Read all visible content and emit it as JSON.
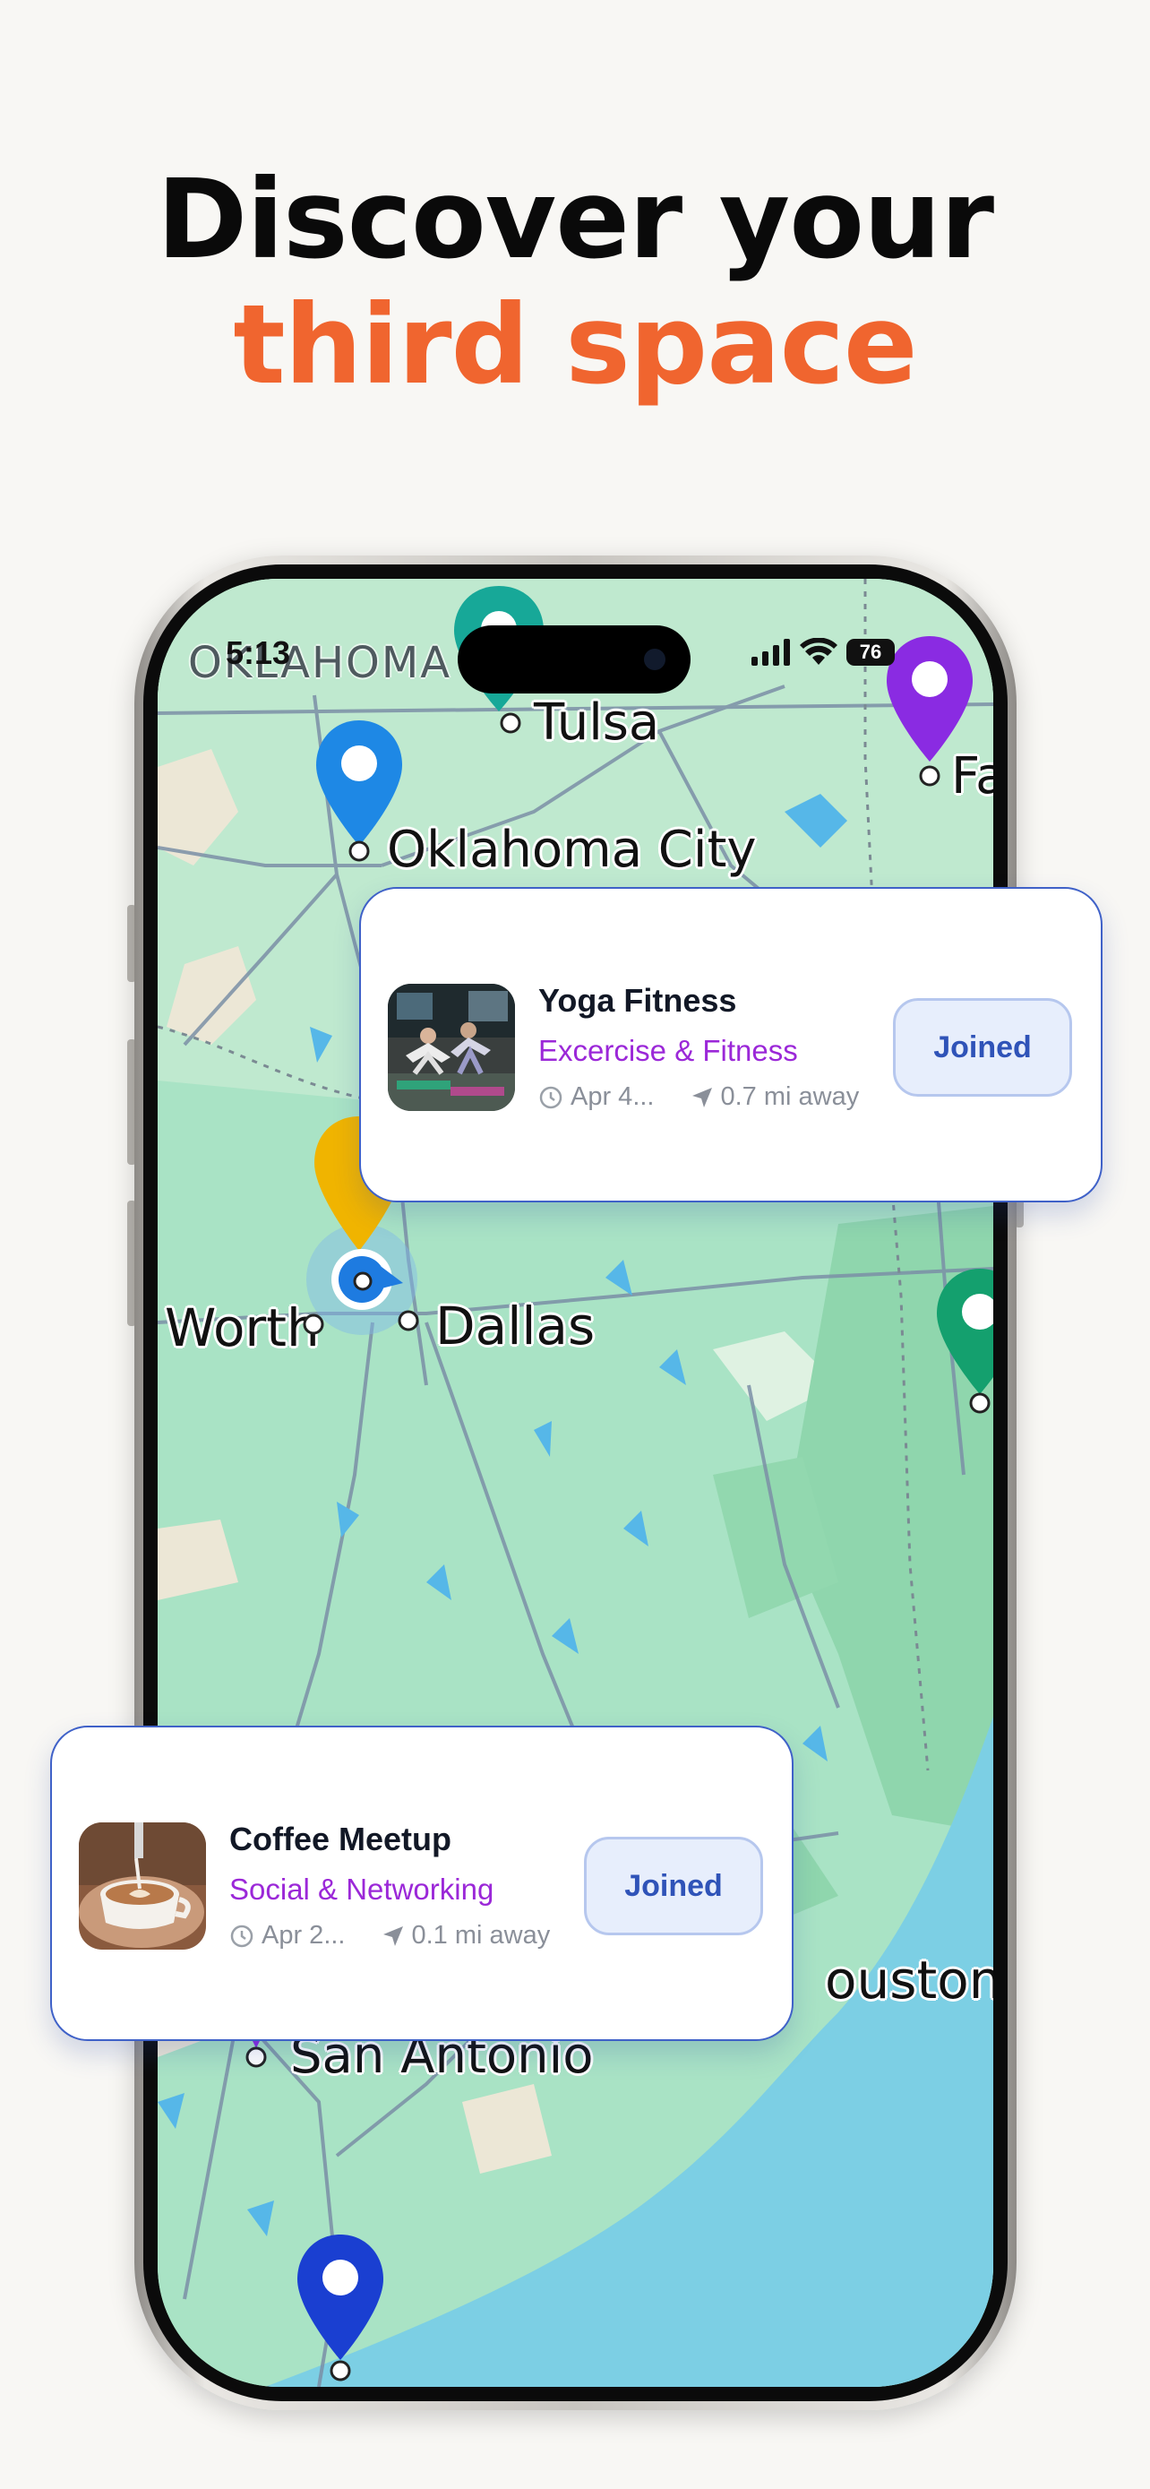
{
  "headline": {
    "line1": "Discover your",
    "line2": "third space"
  },
  "status_bar": {
    "time": "5:13",
    "battery": "76",
    "icons": [
      "signal-bars-icon",
      "wifi-icon",
      "battery-icon"
    ]
  },
  "map": {
    "state_label": "OKLAHOMA",
    "cities": {
      "tulsa": "Tulsa",
      "oklahoma_city": "Oklahoma City",
      "fort_smith_partial": "Fa",
      "fort_worth_partial": "Worth",
      "dallas": "Dallas",
      "houston_partial": "ouston",
      "san_antonio": "San Antonio"
    },
    "pin_colors": {
      "teal": "#17a898",
      "purple": "#8a2be2",
      "blue": "#1e88e5",
      "yellow": "#f0b400",
      "green": "#14a06e",
      "navy": "#1a3fd1"
    }
  },
  "cards": [
    {
      "title": "Yoga Fitness",
      "category": "Excercise & Fitness",
      "date": "Apr 4...",
      "distance": "0.7 mi away",
      "button": "Joined"
    },
    {
      "title": "Coffee Meetup",
      "category": "Social & Networking",
      "date": "Apr 2...",
      "distance": "0.1 mi away",
      "button": "Joined"
    }
  ],
  "colors": {
    "accent_orange": "#f0652f",
    "category_purple": "#9b28d8",
    "joined_blue": "#2f53b8",
    "card_border": "#3f61c8"
  }
}
